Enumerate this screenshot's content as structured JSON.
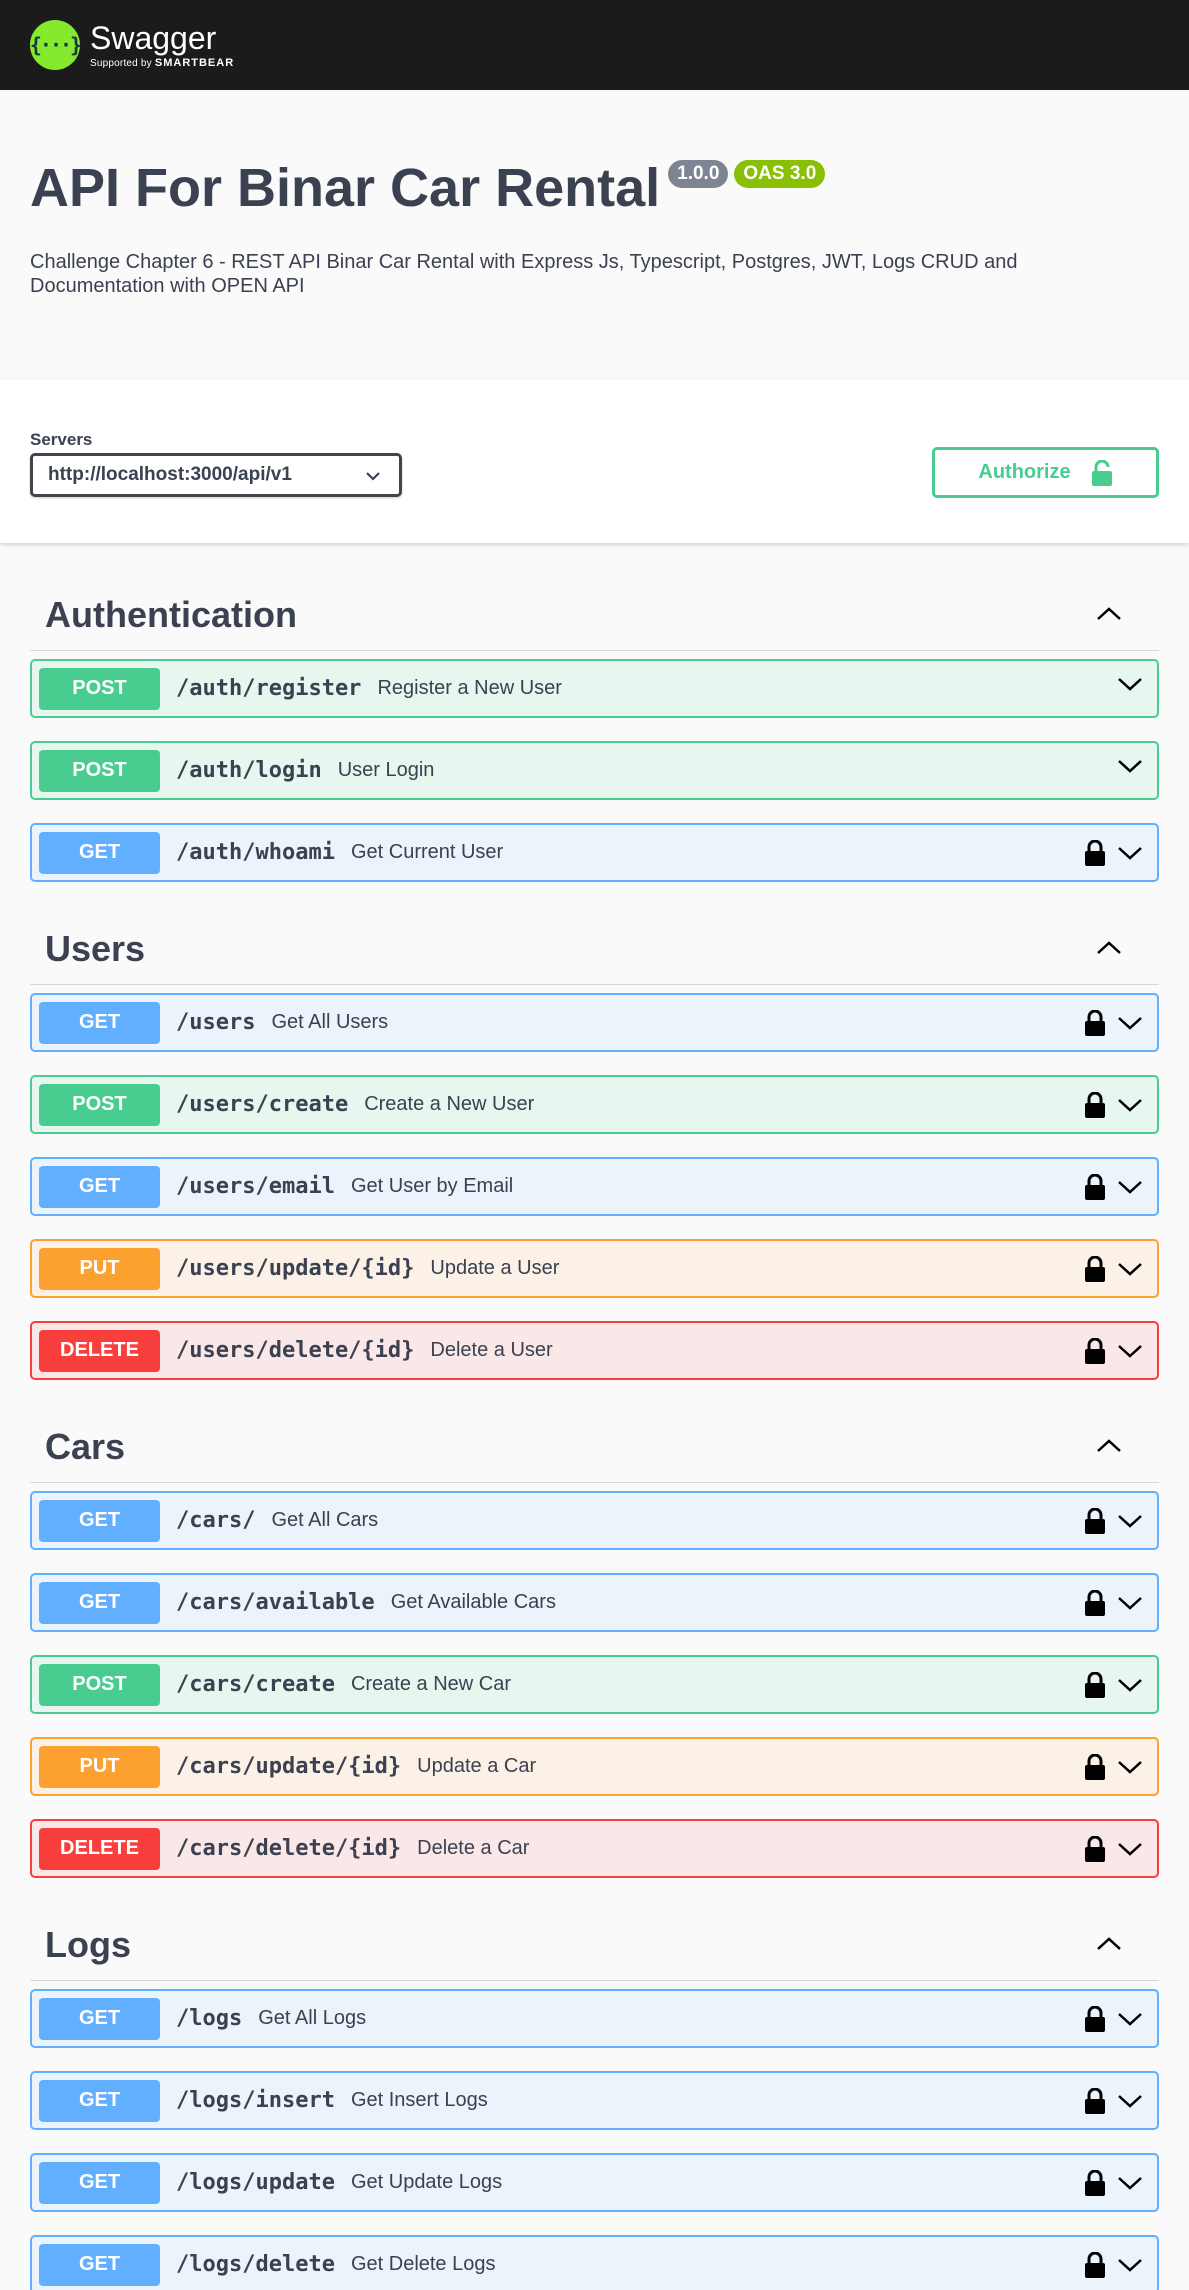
{
  "topbar": {
    "logo_glyph": "{···}",
    "brand": "Swagger",
    "supported_by": "Supported by",
    "company": "SMARTBEAR"
  },
  "info": {
    "title": "API For Binar Car Rental",
    "version": "1.0.0",
    "oas": "OAS 3.0",
    "description": "Challenge Chapter 6 - REST API Binar Car Rental with Express Js, Typescript, Postgres, JWT, Logs CRUD and Documentation with OPEN API"
  },
  "servers": {
    "label": "Servers",
    "selected": "http://localhost:3000/api/v1"
  },
  "authorize_label": "Authorize",
  "colors": {
    "post": "#49cc90",
    "get": "#61affe",
    "put": "#fca130",
    "delete": "#f93e3e"
  },
  "tags": [
    {
      "name": "Authentication",
      "operations": [
        {
          "method": "POST",
          "path": "/auth/register",
          "summary": "Register a New User",
          "locked": false
        },
        {
          "method": "POST",
          "path": "/auth/login",
          "summary": "User Login",
          "locked": false
        },
        {
          "method": "GET",
          "path": "/auth/whoami",
          "summary": "Get Current User",
          "locked": true
        }
      ]
    },
    {
      "name": "Users",
      "operations": [
        {
          "method": "GET",
          "path": "/users",
          "summary": "Get All Users",
          "locked": true
        },
        {
          "method": "POST",
          "path": "/users/create",
          "summary": "Create a New User",
          "locked": true
        },
        {
          "method": "GET",
          "path": "/users/email",
          "summary": "Get User by Email",
          "locked": true
        },
        {
          "method": "PUT",
          "path": "/users/update/{id}",
          "summary": "Update a User",
          "locked": true
        },
        {
          "method": "DELETE",
          "path": "/users/delete/{id}",
          "summary": "Delete a User",
          "locked": true
        }
      ]
    },
    {
      "name": "Cars",
      "operations": [
        {
          "method": "GET",
          "path": "/cars/",
          "summary": "Get All Cars",
          "locked": true
        },
        {
          "method": "GET",
          "path": "/cars/available",
          "summary": "Get Available Cars",
          "locked": true
        },
        {
          "method": "POST",
          "path": "/cars/create",
          "summary": "Create a New Car",
          "locked": true
        },
        {
          "method": "PUT",
          "path": "/cars/update/{id}",
          "summary": "Update a Car",
          "locked": true
        },
        {
          "method": "DELETE",
          "path": "/cars/delete/{id}",
          "summary": "Delete a Car",
          "locked": true
        }
      ]
    },
    {
      "name": "Logs",
      "operations": [
        {
          "method": "GET",
          "path": "/logs",
          "summary": "Get All Logs",
          "locked": true
        },
        {
          "method": "GET",
          "path": "/logs/insert",
          "summary": "Get Insert Logs",
          "locked": true
        },
        {
          "method": "GET",
          "path": "/logs/update",
          "summary": "Get Update Logs",
          "locked": true
        },
        {
          "method": "GET",
          "path": "/logs/delete",
          "summary": "Get Delete Logs",
          "locked": true
        }
      ]
    }
  ]
}
